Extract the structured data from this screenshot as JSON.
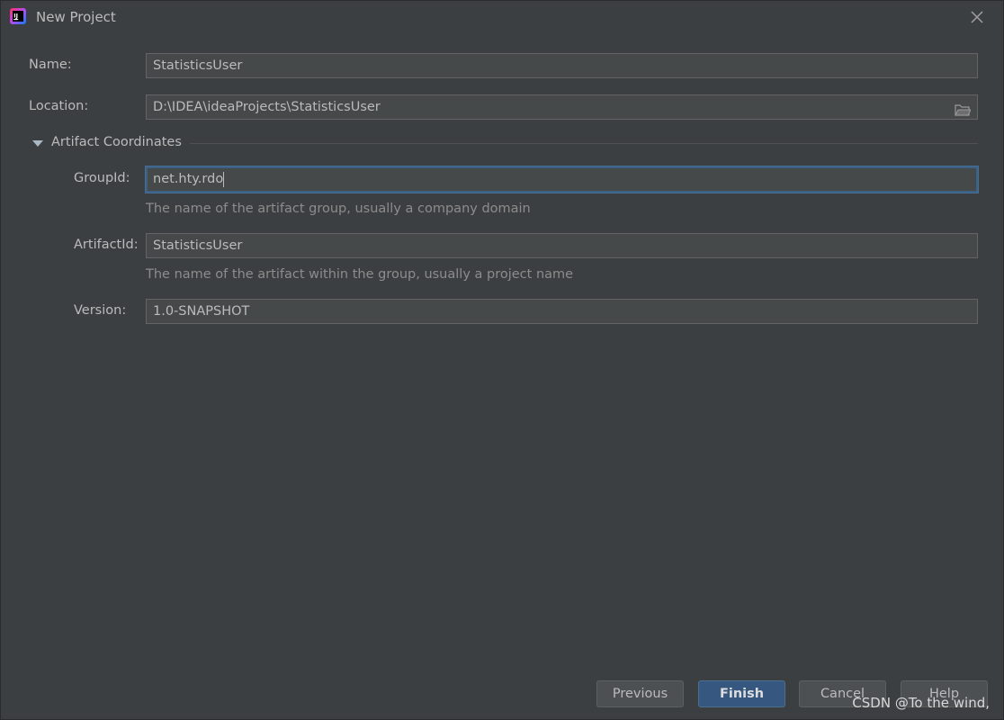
{
  "window": {
    "title": "New Project",
    "app_icon": "intellij-idea-icon",
    "close_icon": "close-icon"
  },
  "form": {
    "name": {
      "label": "Name:",
      "value": "StatisticsUser"
    },
    "location": {
      "label": "Location:",
      "value": "D:\\IDEA\\ideaProjects\\StatisticsUser",
      "browse_icon": "folder-icon"
    },
    "artifact_section": {
      "label": "Artifact Coordinates",
      "expanded": true,
      "toggle_icon": "triangle-down-icon"
    },
    "group_id": {
      "label": "GroupId:",
      "value": "net.hty.rdo",
      "hint": "The name of the artifact group, usually a company domain"
    },
    "artifact_id": {
      "label": "ArtifactId:",
      "value": "StatisticsUser",
      "hint": "The name of the artifact within the group, usually a project name"
    },
    "version": {
      "label": "Version:",
      "value": "1.0-SNAPSHOT"
    }
  },
  "buttons": {
    "previous": "Previous",
    "finish": "Finish",
    "cancel": "Cancel",
    "help": "Help"
  },
  "watermark": "CSDN @To the wind,",
  "colors": {
    "background": "#3c3f41",
    "field_bg": "#45494a",
    "focus_border": "#3d6185",
    "default_button": "#365880",
    "text": "#bbbbbb",
    "hint_text": "#8c8c8c"
  }
}
